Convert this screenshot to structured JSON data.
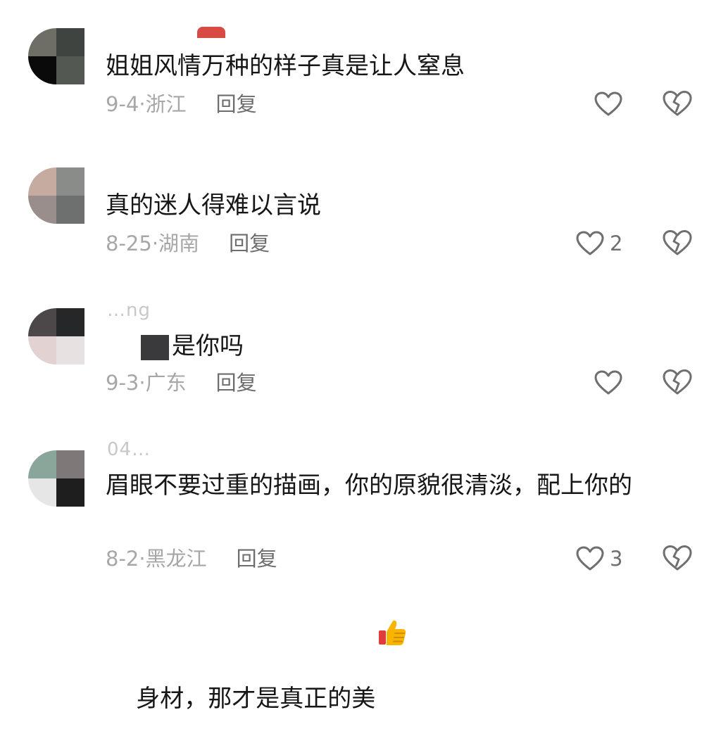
{
  "comments": [
    {
      "username": "",
      "text": "姐姐风情万种的样子真是让人窒息",
      "date": "9-4·",
      "location": "浙江",
      "reply_label": "回复",
      "likes": ""
    },
    {
      "username": "",
      "text": "真的迷人得难以言说",
      "date": "8-25·",
      "location": "湖南",
      "reply_label": "回复",
      "likes": "2"
    },
    {
      "username": "…ng",
      "text": "是你吗",
      "date": "9-3·",
      "location": "广东",
      "reply_label": "回复",
      "likes": ""
    },
    {
      "username": "04…",
      "text_line1": "眉眼不要过重的描画，你的原貌很清淡，配上你的",
      "text_line2": "身材，那才是真正的美",
      "date": "8-2·",
      "location": "黑龙江",
      "reply_label": "回复",
      "likes": "3"
    }
  ],
  "icons": {
    "like": "heart-outline-icon",
    "dislike": "broken-heart-outline-icon",
    "emoji": "thumbs-up-emoji"
  },
  "colors": {
    "text": "#161616",
    "meta": "#a7a7a7",
    "reply": "#6d6d6d",
    "icon": "#6f6f6f"
  }
}
